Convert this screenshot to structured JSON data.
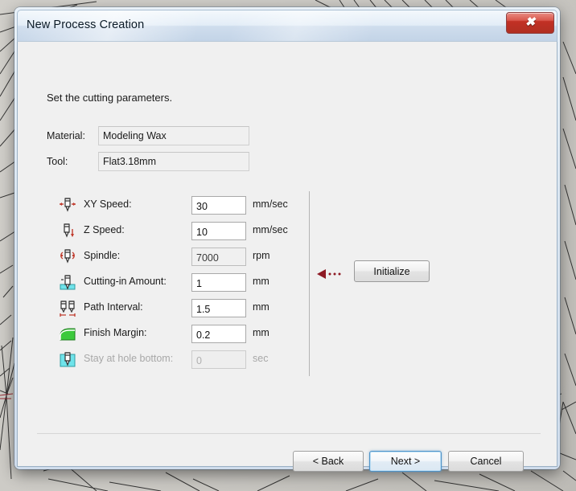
{
  "window": {
    "title": "New Process Creation",
    "close_label": "✖"
  },
  "content": {
    "instruction": "Set the cutting parameters."
  },
  "readouts": [
    {
      "label": "Material:",
      "value": "Modeling Wax",
      "name": "material"
    },
    {
      "label": "Tool:",
      "value": "Flat3.18mm",
      "name": "tool"
    }
  ],
  "parameters": [
    {
      "label": "XY Speed:",
      "value": "30",
      "unit": "mm/sec",
      "state": "editable",
      "icon": "tool-xy-speed-icon"
    },
    {
      "label": "Z Speed:",
      "value": "10",
      "unit": "mm/sec",
      "state": "editable",
      "icon": "tool-z-speed-icon"
    },
    {
      "label": "Spindle:",
      "value": "7000",
      "unit": "rpm",
      "state": "readonly",
      "icon": "tool-spindle-icon"
    },
    {
      "label": "Cutting-in Amount:",
      "value": "1",
      "unit": "mm",
      "state": "editable",
      "icon": "tool-cutting-in-icon"
    },
    {
      "label": "Path Interval:",
      "value": "1.5",
      "unit": "mm",
      "state": "editable",
      "icon": "tool-path-interval-icon"
    },
    {
      "label": "Finish Margin:",
      "value": "0.2",
      "unit": "mm",
      "state": "editable",
      "icon": "finish-margin-icon"
    },
    {
      "label": "Stay at hole bottom:",
      "value": "0",
      "unit": "sec",
      "state": "disabled",
      "icon": "tool-hole-bottom-icon"
    }
  ],
  "initialize": {
    "label": "Initialize",
    "arrow_icon": "left-arrow-dotted-icon"
  },
  "footer": {
    "back_label": "< Back",
    "next_label": "Next >",
    "cancel_label": "Cancel"
  },
  "colors": {
    "accent": "#4f93c8",
    "close_red": "#c23125",
    "icon_red": "#8e1a24",
    "icon_cyan": "#4fd8e0",
    "icon_green": "#3cc93c",
    "window_bg": "#f0f0f0"
  }
}
